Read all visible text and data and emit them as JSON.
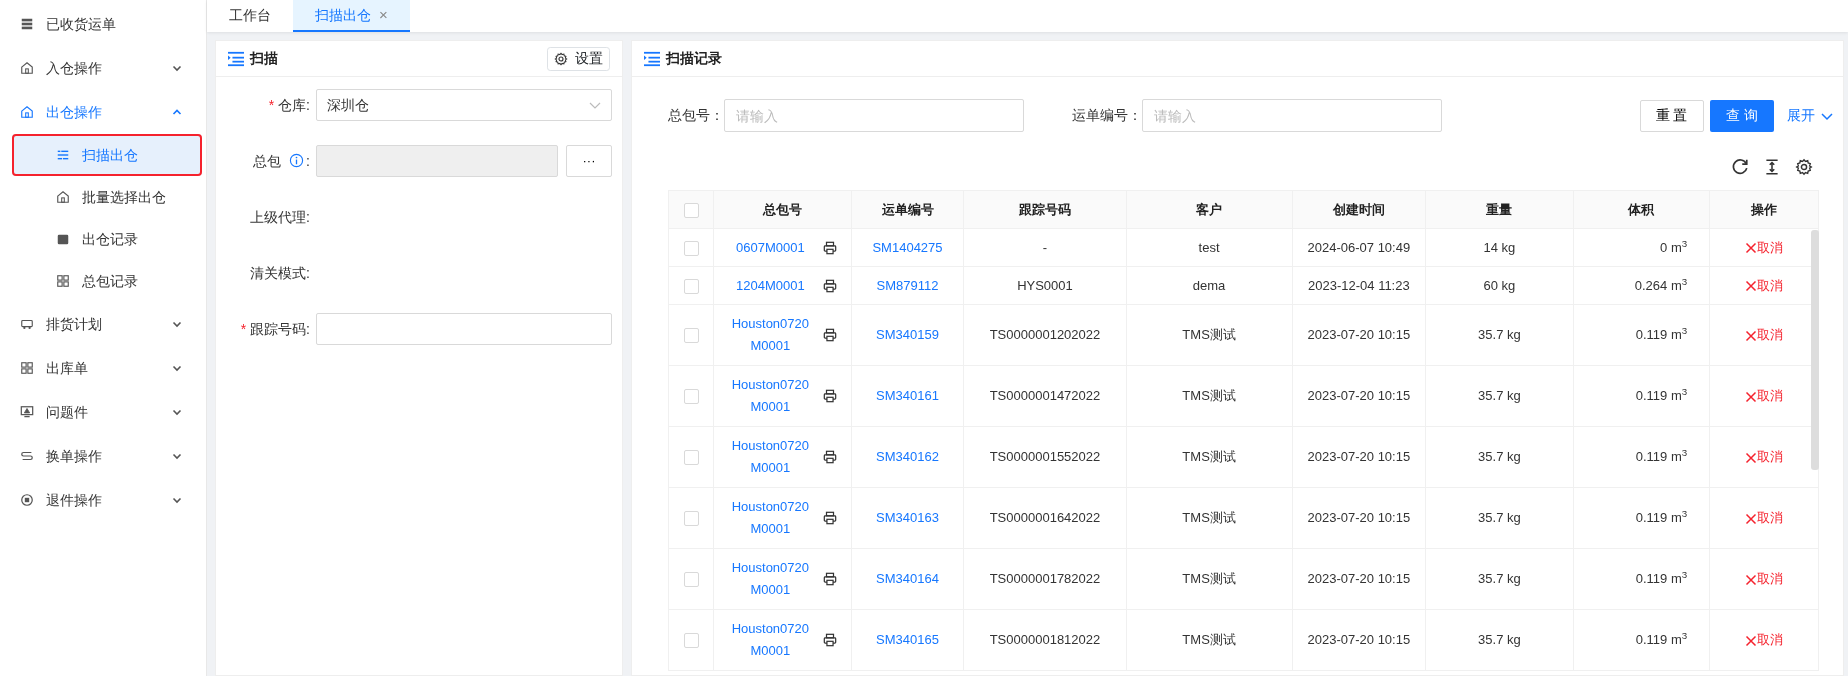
{
  "sidebar": {
    "items": [
      {
        "label": "已收货运单",
        "selected": false
      },
      {
        "label": "入仓操作",
        "expanded": false,
        "selected": false
      },
      {
        "label": "出仓操作",
        "expanded": true,
        "selected": true,
        "children": [
          {
            "label": "扫描出仓",
            "selected": true,
            "highlighted": true
          },
          {
            "label": "批量选择出仓",
            "selected": false,
            "highlighted": false
          },
          {
            "label": "出仓记录",
            "selected": false,
            "highlighted": false
          },
          {
            "label": "总包记录",
            "selected": false,
            "highlighted": false
          }
        ]
      },
      {
        "label": "排货计划",
        "expanded": false,
        "selected": false
      },
      {
        "label": "出库单",
        "expanded": false,
        "selected": false
      },
      {
        "label": "问题件",
        "expanded": false,
        "selected": false
      },
      {
        "label": "换单操作",
        "expanded": false,
        "selected": false
      },
      {
        "label": "退件操作",
        "expanded": false,
        "selected": false
      }
    ]
  },
  "tabs": [
    {
      "label": "工作台",
      "selected": false
    },
    {
      "label": "扫描出仓",
      "selected": true,
      "close": "×"
    }
  ],
  "scan_panel": {
    "title": "扫描",
    "settings_button": "设置",
    "fields": [
      {
        "kind": "select",
        "required_mark": "*",
        "label": "仓库",
        "colon": ":",
        "value": "深圳仓"
      },
      {
        "kind": "picker",
        "label": "总包",
        "info": true,
        "colon": ":",
        "button": "···",
        "disabled": true
      },
      {
        "kind": "static",
        "label": "上级代理",
        "colon": ":"
      },
      {
        "kind": "static",
        "label": "清关模式",
        "colon": ":"
      },
      {
        "kind": "input",
        "required_mark": "*",
        "label": "跟踪号码",
        "colon": ":"
      }
    ]
  },
  "records_panel": {
    "title": "扫描记录",
    "filters": [
      {
        "label": "总包号：",
        "placeholder": "请输入"
      },
      {
        "label": "运单编号：",
        "placeholder": "请输入"
      }
    ],
    "reset_button": "重 置",
    "query_button": "查 询",
    "expand_link": "展开",
    "table": {
      "header_checked": false,
      "columns": [
        "总包号",
        "运单编号",
        "跟踪号码",
        "客户",
        "创建时间",
        "重量",
        "体积",
        "操作"
      ],
      "rows": [
        {
          "checked": false,
          "package": "0607M0001",
          "waybill": "SM1404275",
          "tracking": "-",
          "customer": "test",
          "created": "2024-06-07 10:49",
          "weight": "14 kg",
          "volume": "0 m$^{3}$",
          "action": "取消"
        },
        {
          "checked": false,
          "package": "1204M0001",
          "waybill": "SM879112",
          "tracking": "HYS0001",
          "customer": "dema",
          "created": "2023-12-04 11:23",
          "weight": "60 kg",
          "volume": "0.264 m$^{3}$",
          "action": "取消"
        },
        {
          "checked": false,
          "package": "Houston0720M0001",
          "waybill": "SM340159",
          "tracking": "TS0000001202022",
          "customer": "TMS测试",
          "created": "2023-07-20 10:15",
          "weight": "35.7 kg",
          "volume": "0.119 m$^{3}$",
          "action": "取消"
        },
        {
          "checked": false,
          "package": "Houston0720M0001",
          "waybill": "SM340161",
          "tracking": "TS0000001472022",
          "customer": "TMS测试",
          "created": "2023-07-20 10:15",
          "weight": "35.7 kg",
          "volume": "0.119 m$^{3}$",
          "action": "取消"
        },
        {
          "checked": false,
          "package": "Houston0720M0001",
          "waybill": "SM340162",
          "tracking": "TS0000001552022",
          "customer": "TMS测试",
          "created": "2023-07-20 10:15",
          "weight": "35.7 kg",
          "volume": "0.119 m$^{3}$",
          "action": "取消"
        },
        {
          "checked": false,
          "package": "Houston0720M0001",
          "waybill": "SM340163",
          "tracking": "TS0000001642022",
          "customer": "TMS测试",
          "created": "2023-07-20 10:15",
          "weight": "35.7 kg",
          "volume": "0.119 m$^{3}$",
          "action": "取消"
        },
        {
          "checked": false,
          "package": "Houston0720M0001",
          "waybill": "SM340164",
          "tracking": "TS0000001782022",
          "customer": "TMS测试",
          "created": "2023-07-20 10:15",
          "weight": "35.7 kg",
          "volume": "0.119 m$^{3}$",
          "action": "取消"
        },
        {
          "checked": false,
          "package": "Houston0720M0001",
          "waybill": "SM340165",
          "tracking": "TS0000001812022",
          "customer": "TMS测试",
          "created": "2023-07-20 10:15",
          "weight": "35.7 kg",
          "volume": "0.119 m$^{3}$",
          "action": "取消"
        }
      ]
    }
  }
}
